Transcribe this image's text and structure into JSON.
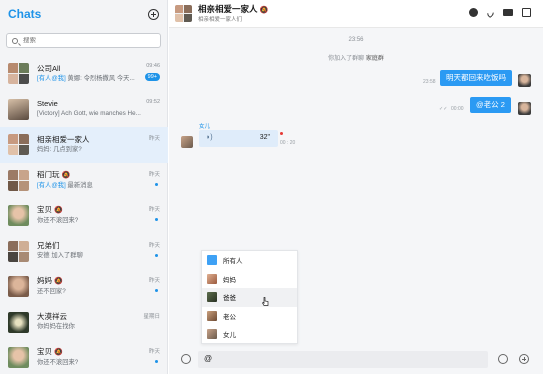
{
  "sidebar": {
    "title": "Chats",
    "search": {
      "placeholder": "搜索",
      "value": ""
    },
    "items": [
      {
        "name": "公司All",
        "time": "09:46",
        "tag": "[有人@我]",
        "message": "黄娜: 令烈杨撒风 今天...",
        "badge": "99+"
      },
      {
        "name": "Stevie",
        "time": "09:52",
        "tag": "",
        "message": "[Victory] Ach Gott, wie manches He...",
        "badge": ""
      },
      {
        "name": "相亲相爱一家人",
        "time": "昨天",
        "tag": "",
        "message": "妈妈: 几点到家?",
        "badge": ""
      },
      {
        "name": "稻门玩",
        "mute": "🔕",
        "time": "昨天",
        "tag": "[有人@我]",
        "message": "最新消息",
        "badge": ""
      },
      {
        "name": "宝贝",
        "mute": "🔕",
        "time": "昨天",
        "tag": "",
        "message": "你还不滚回来?",
        "badge": ""
      },
      {
        "name": "兄弟们",
        "time": "昨天",
        "tag": "",
        "message": "安德 加入了群聊",
        "badge": ""
      },
      {
        "name": "妈妈",
        "mute": "🔕",
        "time": "昨天",
        "tag": "",
        "message": "还不回家?",
        "badge": ""
      },
      {
        "name": "大漠祥云",
        "time": "星期日",
        "tag": "",
        "message": "你妈妈在找你",
        "badge": ""
      },
      {
        "name": "宝贝",
        "mute": "🔕",
        "time": "昨天",
        "tag": "",
        "message": "你还不滚回来?",
        "badge": ""
      }
    ]
  },
  "chat": {
    "title": "相亲相爱一家人",
    "title_mute": "🔕",
    "subtitle": "相亲相爱一家人们",
    "system_time": "23:56",
    "system_message_prefix": "你加入了群聊",
    "system_message_group": "家庭群",
    "messages": [
      {
        "text": "明天都回来吃饭吗",
        "time": "23:58"
      },
      {
        "text": "@老公 2",
        "time": "00:00"
      }
    ],
    "voice": {
      "sender": "女儿",
      "duration": "32\"",
      "time": "00 : 20"
    },
    "mention_list": [
      {
        "label": "所有人"
      },
      {
        "label": "妈妈"
      },
      {
        "label": "爸爸"
      },
      {
        "label": "老公"
      },
      {
        "label": "女儿"
      }
    ],
    "input": {
      "value": "@"
    }
  },
  "colors": {
    "accent": "#1e93e8",
    "bubble": "#2b9af3",
    "sidebar_bg": "#f3f4f6",
    "active_row": "#e4effb"
  },
  "icons": [
    "add-chat-icon",
    "search-icon",
    "group-info-icon",
    "phone-icon",
    "video-icon",
    "more-icon",
    "microphone-icon",
    "emoji-icon",
    "plus-icon"
  ]
}
